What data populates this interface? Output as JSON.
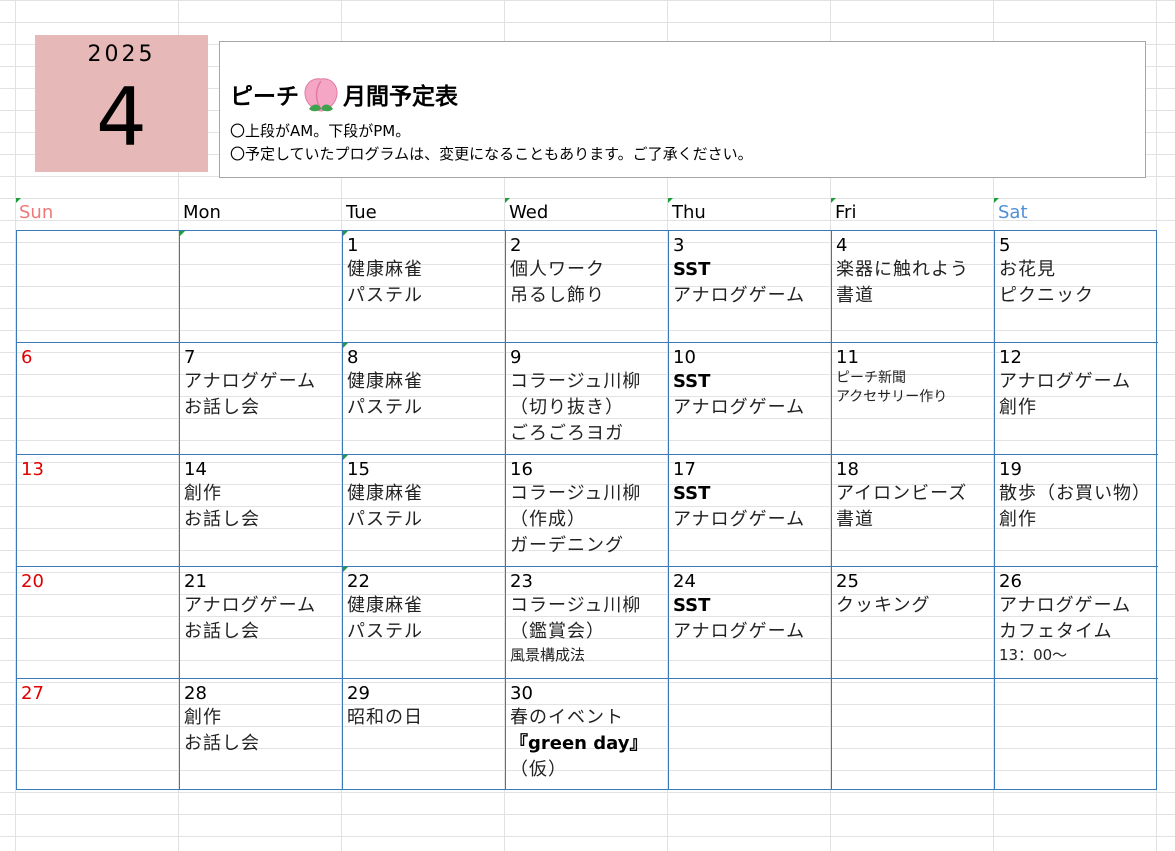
{
  "header": {
    "year": "2025",
    "month": "4",
    "title_part1": "ピーチ",
    "title_part2": "月間予定表",
    "note1": "〇上段がAM。下段がPM。",
    "note2": "〇予定していたプログラムは、変更になることもあります。ご了承ください。"
  },
  "days_of_week": [
    "Sun",
    "Mon",
    "Tue",
    "Wed",
    "Thu",
    "Fri",
    "Sat"
  ],
  "weeks": [
    [
      {
        "num": "",
        "acts": []
      },
      {
        "num": "",
        "acts": []
      },
      {
        "num": "1",
        "acts": [
          "健康麻雀",
          "パステル"
        ]
      },
      {
        "num": "2",
        "acts": [
          "個人ワーク",
          "吊るし飾り"
        ]
      },
      {
        "num": "3",
        "acts": [
          "SST",
          "アナログゲーム"
        ]
      },
      {
        "num": "4",
        "acts": [
          "楽器に触れよう",
          "書道"
        ]
      },
      {
        "num": "5",
        "acts": [
          "お花見",
          "ピクニック"
        ]
      }
    ],
    [
      {
        "num": "6",
        "acts": []
      },
      {
        "num": "7",
        "acts": [
          "アナログゲーム",
          "お話し会"
        ]
      },
      {
        "num": "8",
        "acts": [
          "健康麻雀",
          "パステル"
        ]
      },
      {
        "num": "9",
        "acts": [
          "コラージュ川柳",
          "（切り抜き）",
          "ごろごろヨガ"
        ]
      },
      {
        "num": "10",
        "acts": [
          "SST",
          "アナログゲーム"
        ]
      },
      {
        "num": "11",
        "acts": [
          "ピーチ新聞",
          "アクセサリー作り"
        ]
      },
      {
        "num": "12",
        "acts": [
          "アナログゲーム",
          "創作"
        ]
      }
    ],
    [
      {
        "num": "13",
        "acts": []
      },
      {
        "num": "14",
        "acts": [
          "創作",
          "お話し会"
        ]
      },
      {
        "num": "15",
        "acts": [
          "健康麻雀",
          "パステル"
        ]
      },
      {
        "num": "16",
        "acts": [
          "コラージュ川柳",
          "（作成）",
          "ガーデニング"
        ]
      },
      {
        "num": "17",
        "acts": [
          "SST",
          "アナログゲーム"
        ]
      },
      {
        "num": "18",
        "acts": [
          "アイロンビーズ",
          "書道"
        ]
      },
      {
        "num": "19",
        "acts": [
          "散歩（お買い物）",
          "創作"
        ]
      }
    ],
    [
      {
        "num": "20",
        "acts": []
      },
      {
        "num": "21",
        "acts": [
          "アナログゲーム",
          "お話し会"
        ]
      },
      {
        "num": "22",
        "acts": [
          "健康麻雀",
          "パステル"
        ]
      },
      {
        "num": "23",
        "acts": [
          "コラージュ川柳",
          "（鑑賞会）",
          "風景構成法"
        ]
      },
      {
        "num": "24",
        "acts": [
          "SST",
          "アナログゲーム"
        ]
      },
      {
        "num": "25",
        "acts": [
          "クッキング"
        ]
      },
      {
        "num": "26",
        "acts": [
          "アナログゲーム",
          "カフェタイム",
          "13：00～"
        ]
      }
    ],
    [
      {
        "num": "27",
        "acts": []
      },
      {
        "num": "28",
        "acts": [
          "創作",
          "お話し会"
        ]
      },
      {
        "num": "29",
        "acts": [
          "昭和の日"
        ]
      },
      {
        "num": "30",
        "acts": [
          "春のイベント",
          "『green day』",
          "（仮）"
        ]
      },
      {
        "num": "",
        "acts": []
      },
      {
        "num": "",
        "acts": []
      },
      {
        "num": "",
        "acts": []
      }
    ]
  ],
  "colors": {
    "month_block": "#e6b8b7",
    "sunday_header": "#f07878",
    "saturday_header": "#4f8fd6",
    "sunday_date": "#e00000",
    "grid_border": "#3a7ab8",
    "cell_marker": "#1e9e3a"
  },
  "icons": {
    "title_icon": "peach-icon"
  }
}
